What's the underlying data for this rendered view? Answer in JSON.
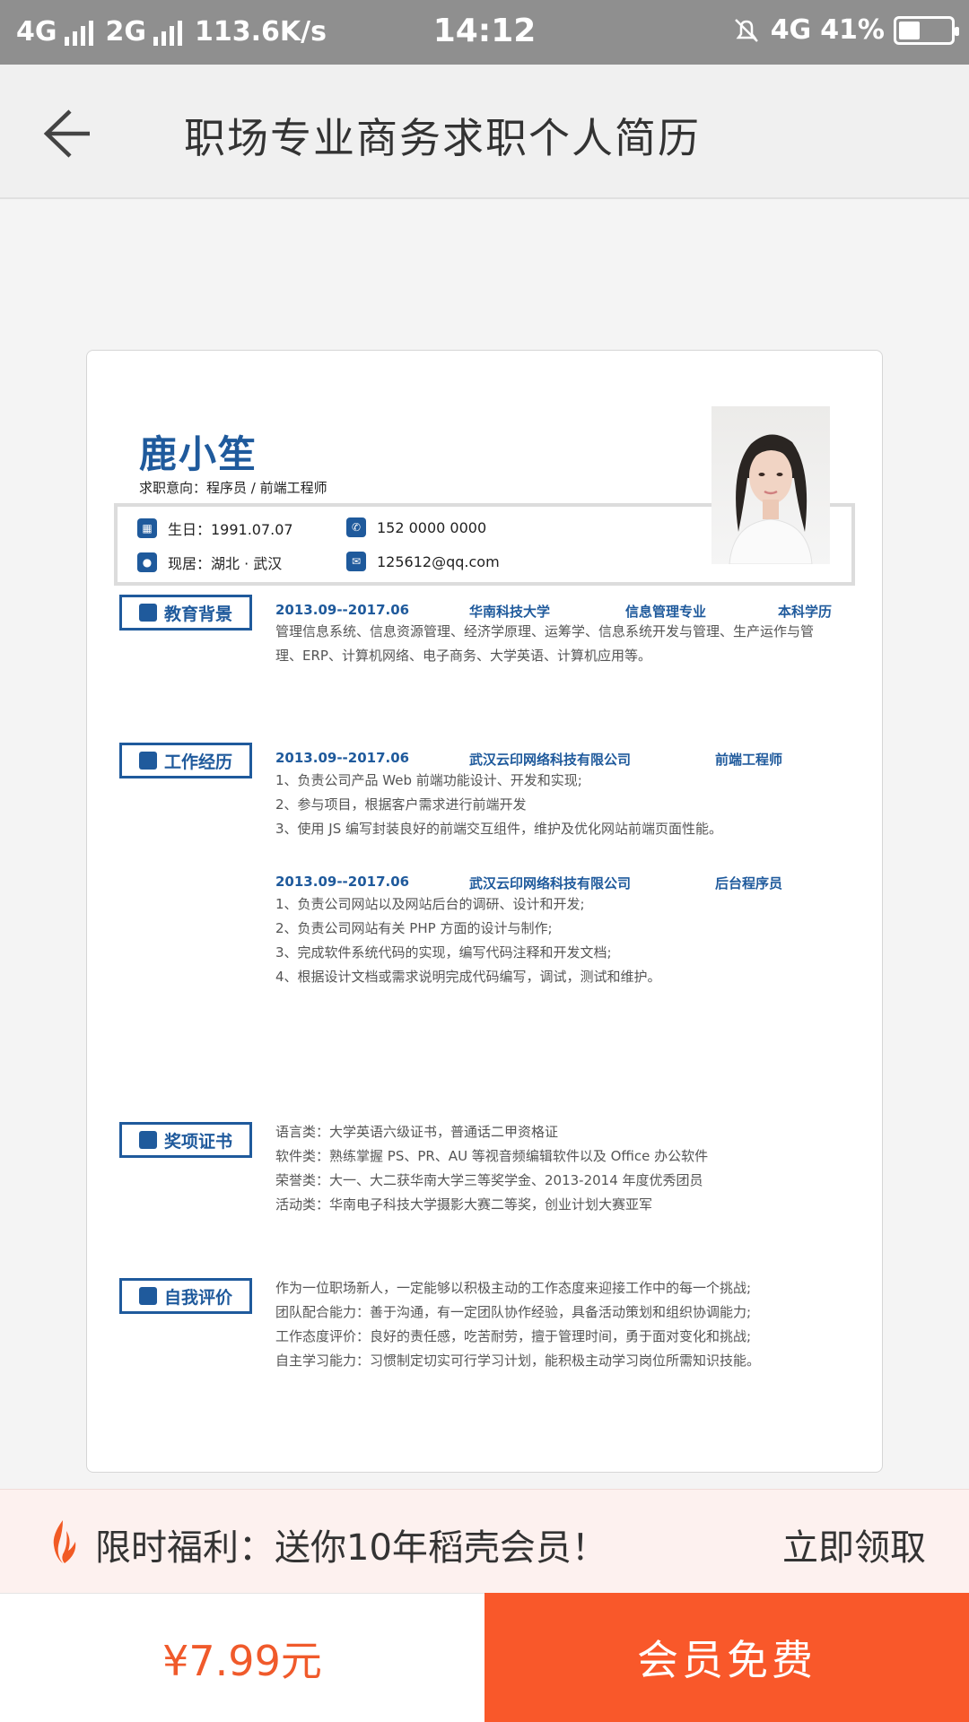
{
  "status_bar": {
    "net1": "4G",
    "net2": "2G",
    "speed": "113.6K/s",
    "time": "14:12",
    "net3": "4G",
    "battery_level": 0.41,
    "battery_text": "41%"
  },
  "app_bar": {
    "title": "职场专业商务求职个人简历"
  },
  "resume": {
    "name": "鹿小笙",
    "intent": "求职意向：程序员 / 前端工程师",
    "birth": "生日：1991.07.07",
    "residence": "现居：湖北 · 武汉",
    "phone": "152 0000 0000",
    "email": "125612@qq.com",
    "education": {
      "label": "教育背景",
      "date": "2013.09--2017.06",
      "school": "华南科技大学",
      "major": "信息管理专业",
      "degree": "本科学历",
      "lines": [
        "管理信息系统、信息资源管理、经济学原理、运筹学、信息系统开发与管理、生产运作与管",
        "理、ERP、计算机网络、电子商务、大学英语、计算机应用等。"
      ]
    },
    "work": {
      "label": "工作经历",
      "jobs": [
        {
          "date": "2013.09--2017.06",
          "company": "武汉云印网络科技有限公司",
          "role": "前端工程师",
          "lines": [
            "1、负责公司产品 Web 前端功能设计、开发和实现;",
            "2、参与项目，根据客户需求进行前端开发",
            "3、使用 JS 编写封装良好的前端交互组件，维护及优化网站前端页面性能。"
          ]
        },
        {
          "date": "2013.09--2017.06",
          "company": "武汉云印网络科技有限公司",
          "role": "后台程序员",
          "lines": [
            "1、负责公司网站以及网站后台的调研、设计和开发;",
            "2、负责公司网站有关 PHP 方面的设计与制作;",
            "3、完成软件系统代码的实现，编写代码注释和开发文档;",
            "4、根据设计文档或需求说明完成代码编写，调试，测试和维护。"
          ]
        }
      ]
    },
    "awards": {
      "label": "奖项证书",
      "lines": [
        "语言类：大学英语六级证书，普通话二甲资格证",
        "软件类：熟练掌握 PS、PR、AU 等视音频编辑软件以及 Office 办公软件",
        "荣誉类：大一、大二获华南大学三等奖学金、2013-2014 年度优秀团员",
        "活动类：华南电子科技大学摄影大赛二等奖，创业计划大赛亚军"
      ]
    },
    "self": {
      "label": "自我评价",
      "lines": [
        "作为一位职场新人，一定能够以积极主动的工作态度来迎接工作中的每一个挑战;",
        "团队配合能力：善于沟通，有一定团队协作经验，具备活动策划和组织协调能力;",
        "工作态度评价：良好的责任感，吃苦耐劳，擅于管理时间，勇于面对变化和挑战;",
        "自主学习能力：习惯制定切实可行学习计划，能积极主动学习岗位所需知识技能。"
      ]
    }
  },
  "promo": {
    "text": "限时福利：送你10年稻壳会员！",
    "link": "立即领取"
  },
  "bottom": {
    "price": "¥7.99元",
    "member_button": "会员免费"
  },
  "colors": {
    "accent_blue": "#1f5a9c",
    "orange": "#f9582a",
    "status_bar": "#8f8f8f"
  }
}
